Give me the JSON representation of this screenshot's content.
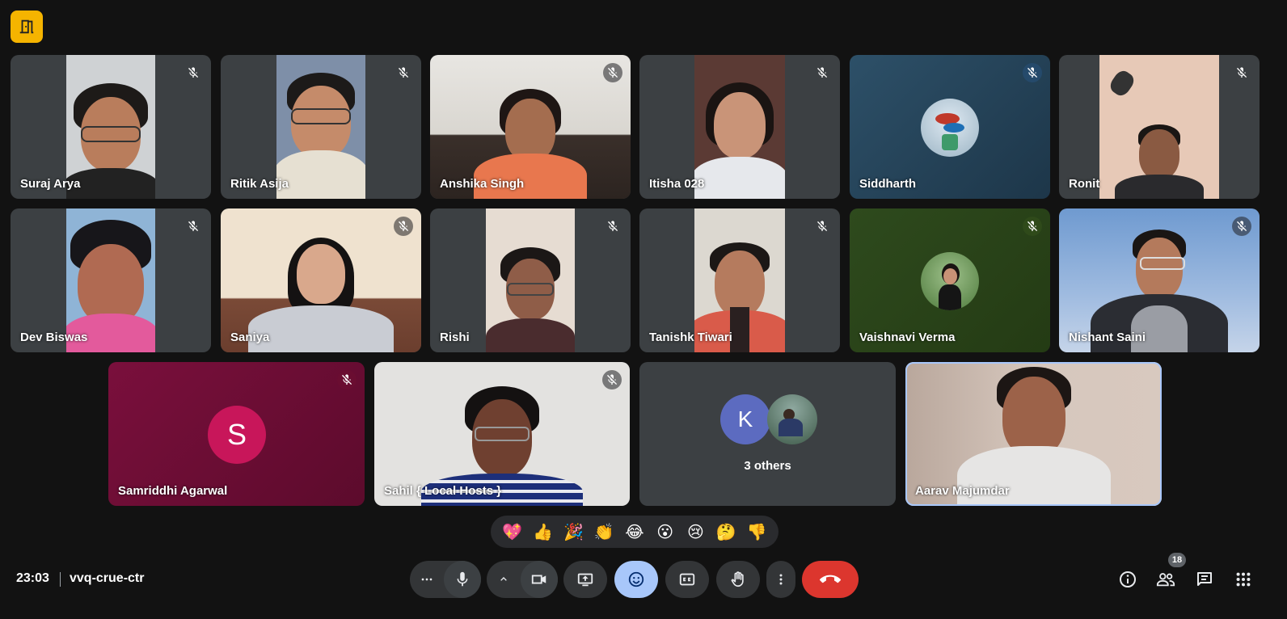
{
  "meeting": {
    "time": "23:03",
    "code": "vvq-crue-ctr"
  },
  "participants": [
    {
      "name": "Suraj Arya"
    },
    {
      "name": "Ritik Asija"
    },
    {
      "name": "Anshika Singh"
    },
    {
      "name": "Itisha 028"
    },
    {
      "name": "Siddharth"
    },
    {
      "name": "Ronit"
    },
    {
      "name": "Dev Biswas"
    },
    {
      "name": "Saniya"
    },
    {
      "name": "Rishi"
    },
    {
      "name": "Tanishk Tiwari"
    },
    {
      "name": "Vaishnavi Verma"
    },
    {
      "name": "Nishant Saini"
    },
    {
      "name": "Samriddhi Agarwal",
      "initial": "S"
    },
    {
      "name": "Sahil { Local Hosts }"
    },
    {
      "name": "Aarav Majumdar"
    }
  ],
  "others": {
    "label": "3 others",
    "initial": "K"
  },
  "reactions": [
    "💖",
    "👍",
    "🎉",
    "👏",
    "😂",
    "😮",
    "😢",
    "🤔",
    "👎"
  ],
  "people_count": "18",
  "colors": {
    "background": "#121212",
    "tile": "#3c4043",
    "end_call": "#dc362e",
    "active_control": "#a8c7fa",
    "app_icon": "#f5b400"
  },
  "icons": {
    "app": "door-icon",
    "mic_off": "mic-off-icon",
    "more": "more-horiz-icon",
    "mic": "mic-icon",
    "camera": "videocam-icon",
    "present": "present-screen-icon",
    "emoji": "emoji-icon",
    "captions": "closed-captions-icon",
    "hand": "raise-hand-icon",
    "more_vert": "more-vert-icon",
    "end_call": "call-end-icon",
    "info": "info-icon",
    "people": "people-icon",
    "chat": "chat-icon",
    "activities": "apps-grid-icon"
  }
}
